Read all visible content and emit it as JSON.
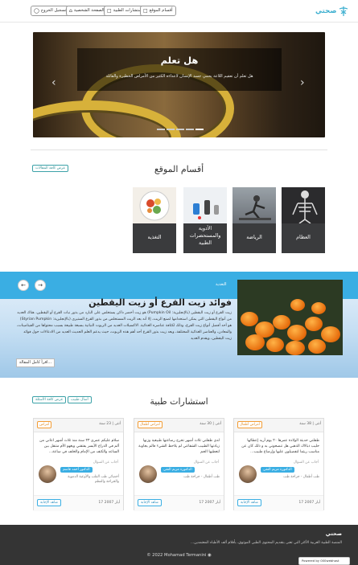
{
  "navbar": {
    "brand": "صحتي",
    "buttons": [
      {
        "label": "أقسام الموقع"
      },
      {
        "label": "الاستشارات الطبية"
      },
      {
        "label": "الصفحة الشخصية"
      },
      {
        "label": "تسجيل الخروج"
      }
    ]
  },
  "carousel": {
    "title": "هل تعلم",
    "text": "هل تعلم أن تعقيم اللاعة يحمي جسد الإنسان لاعداءه الكثير من الأمراض الخطيرة والقاتلة",
    "prev": "‹",
    "next": "›",
    "active_slide": 5,
    "slide_count": 5
  },
  "sections": {
    "title": "أقسام الموقع",
    "view_all": "عرض كافة المقالات",
    "cards": [
      {
        "label": "العظام"
      },
      {
        "label": "الرياضة"
      },
      {
        "label": "الأدوية والمستحضرات الطبية"
      },
      {
        "label": "التغذية"
      }
    ]
  },
  "article": {
    "tag": "التغذية",
    "title": "فوائد زيت القرع أو زيت اليقطين",
    "body": "زيت القرع أو زيت اليقطين (بالإنجليزية: Pumpkin Oil) هو زيت أخضر داكن يستخلص على البارد من بذور نبات القرع أو اليقطين، هناك العديد من أنواع اليقطين التي يمكن استخدامها لصنع الزيت، إلا أنه يعد الزيت المستخلص من بذور القرع الستيري (بالإنجليزية: Styrian Pumpkin) هو أحد أفضل أنواع زيت القرع، وذلك لكثافة عناصره الغذائية. الاكسيلات العديد من الزيوت النباتية بسبعة طبيعة بسبب محتواها من الفيتامينات، والمعادن، والعناصر الغذائية المختلفة، ويعد زيت بذور القرع أحد أهم هذه الزيوت، حيث يدعم العلم الحديث العديد من الادعاءات حول فوائد زيت اليقطين، ويقدم العديد",
    "read_more": "اقرأ كامل المقالة...",
    "prev": "←",
    "next": "→"
  },
  "consultations": {
    "title": "استشارات طبية",
    "view_all": "عرض كافة الأسئلة",
    "ask": "أسأل طبيب",
    "asked_label": "أجاب عن السؤال",
    "view_label": "شاهد الإجابة",
    "items": [
      {
        "age": "أنثى | 38 سنة",
        "tag": "أمراض أطفال",
        "question": "طفلتي حديثة الولادة عمرها ٢٠ يوم أريد إعطائها حليب ذبالاك الذهبي هل تنصحوني به و ذلك كان عن مناسب ريثما لتفصيلون عليها وإرضاع طبيب...",
        "doctor": "الدكتورة مريم النقي",
        "specialty": "طب أطفال - جراحة طب",
        "date": "17 أيار 2007"
      },
      {
        "age": "أنثى | 30 سنة",
        "tag": "أمراض أطفال",
        "question": "لدي طفلتي ثلاث أشهر تخرج رضاعتها طبيعية وزنها زيادتها الطبيب الشقاعي لم يلاحظ الشيء فالم يجاوبة لتعطيها الجم",
        "doctor": "الدكتورة مريم النقي",
        "specialty": "طب أطفال - جراحة طب",
        "date": "17 أيار 2007"
      },
      {
        "age": "أنثى | 23 سنة",
        "tag": "أمراض",
        "question": "سلام عليكم عمري ٢٣ سنة منذ ثلاث أشهر اعاني من ألم في الذراع الأيسر يفتقني ويغهو الأم متنقل بين الساعد والكتف من الإمام والخلف في ساعة...",
        "doctor": "الدكتور أحمد قاسم",
        "specialty": "أخصائي طب القلب والأوعية الدموية والجراحة والعظم",
        "date": "17 أيار 2007"
      }
    ]
  },
  "footer": {
    "title": "صحتي",
    "text": "المنصة الطبية العربية الأكثر التي تعنى بتقديم المحتوى الطبي الموثوق، بأقلام ألف الأطباء المعتمدين...",
    "copyright": "© 2022 Mohamad Termanini",
    "badge": "Powered by 000webhost"
  }
}
